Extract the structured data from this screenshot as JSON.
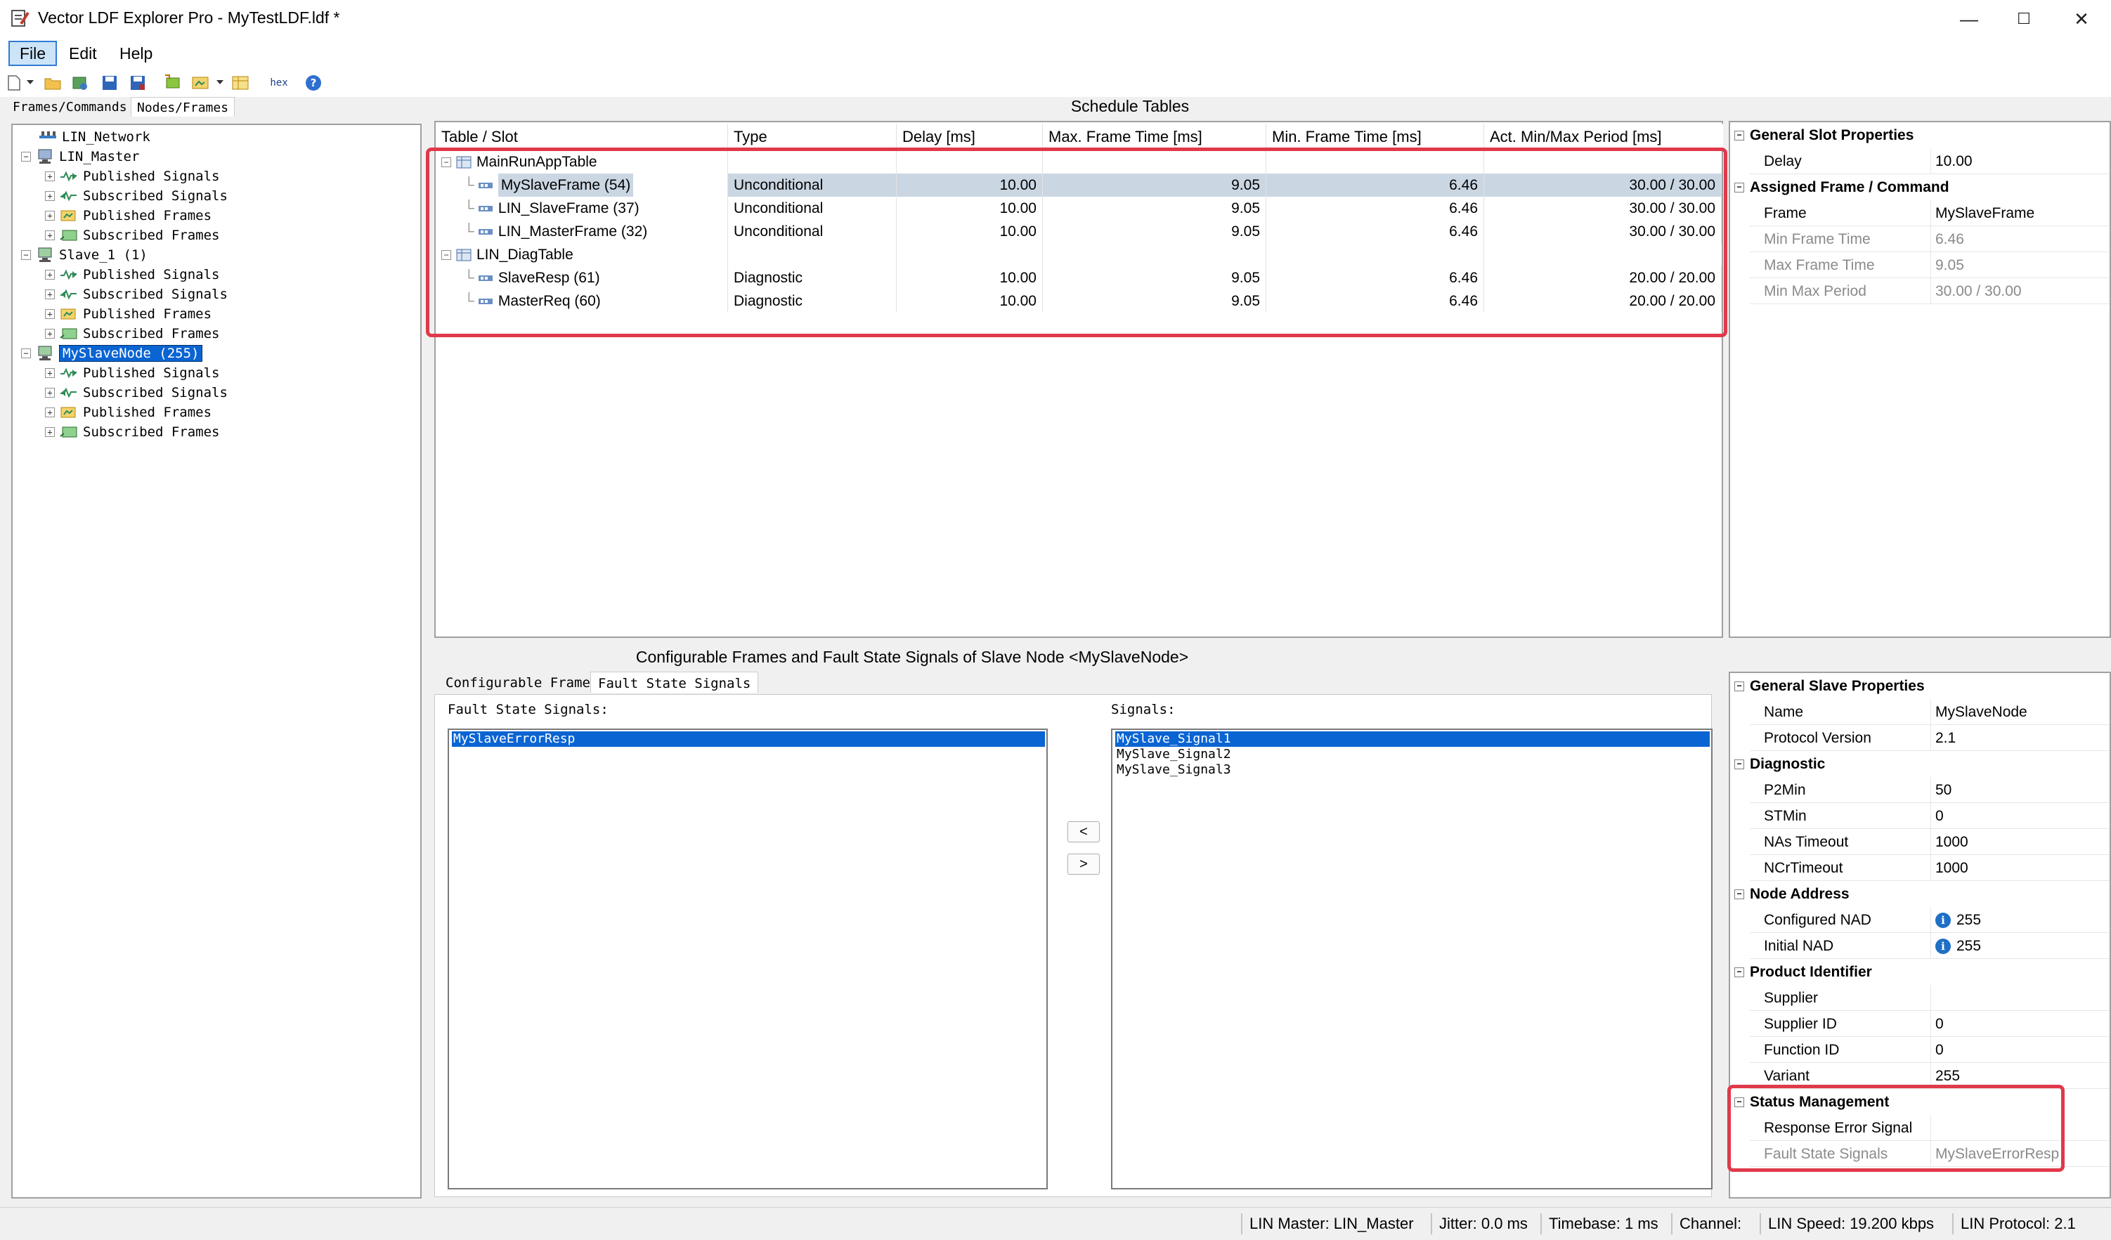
{
  "window": {
    "title": "Vector LDF Explorer Pro - MyTestLDF.ldf *",
    "minimize": "—",
    "maximize": "☐",
    "close": "✕"
  },
  "menu": {
    "file": "File",
    "edit": "Edit",
    "help": "Help"
  },
  "toolbar": {
    "hex_label": "hex"
  },
  "left_tabs": {
    "frames_commands": "Frames/Commands",
    "nodes_frames": "Nodes/Frames"
  },
  "tree": {
    "network": "LIN_Network",
    "master": "LIN_Master",
    "master_children": [
      "Published Signals",
      "Subscribed Signals",
      "Published Frames",
      "Subscribed Frames"
    ],
    "slave1": "Slave_1 (1)",
    "slave1_children": [
      "Published Signals",
      "Subscribed Signals",
      "Published Frames",
      "Subscribed Frames"
    ],
    "myslave": "MySlaveNode (255)",
    "myslave_children": [
      "Published Signals",
      "Subscribed Signals",
      "Published Frames",
      "Subscribed Frames"
    ]
  },
  "schedule": {
    "title": "Schedule Tables",
    "columns": [
      "Table / Slot",
      "Type",
      "Delay [ms]",
      "Max. Frame Time [ms]",
      "Min. Frame Time [ms]",
      "Act. Min/Max Period [ms]"
    ],
    "tables": [
      {
        "name": "MainRunAppTable",
        "slots": [
          {
            "name": "MySlaveFrame (54)",
            "type": "Unconditional",
            "delay": "10.00",
            "max": "9.05",
            "min": "6.46",
            "period": "30.00 / 30.00",
            "selected": true
          },
          {
            "name": "LIN_SlaveFrame (37)",
            "type": "Unconditional",
            "delay": "10.00",
            "max": "9.05",
            "min": "6.46",
            "period": "30.00 / 30.00"
          },
          {
            "name": "LIN_MasterFrame (32)",
            "type": "Unconditional",
            "delay": "10.00",
            "max": "9.05",
            "min": "6.46",
            "period": "30.00 / 30.00"
          }
        ]
      },
      {
        "name": "LIN_DiagTable",
        "slots": [
          {
            "name": "SlaveResp (61)",
            "type": "Diagnostic",
            "delay": "10.00",
            "max": "9.05",
            "min": "6.46",
            "period": "20.00 / 20.00"
          },
          {
            "name": "MasterReq (60)",
            "type": "Diagnostic",
            "delay": "10.00",
            "max": "9.05",
            "min": "6.46",
            "period": "20.00 / 20.00"
          }
        ]
      }
    ]
  },
  "slot_props": {
    "general_title": "General Slot Properties",
    "delay_label": "Delay",
    "delay_value": "10.00",
    "assigned_title": "Assigned Frame / Command",
    "frame_label": "Frame",
    "frame_value": "MySlaveFrame",
    "min_frame_label": "Min Frame Time",
    "min_frame_value": "6.46",
    "max_frame_label": "Max Frame Time",
    "max_frame_value": "9.05",
    "minmax_label": "Min Max Period",
    "minmax_value": "30.00 / 30.00"
  },
  "config": {
    "title": "Configurable Frames and Fault State Signals of Slave Node <MySlaveNode>",
    "tab_configurable": "Configurable Frames",
    "tab_fault": "Fault State Signals",
    "fault_label": "Fault State Signals:",
    "fault_items": [
      "MySlaveErrorResp"
    ],
    "signals_label": "Signals:",
    "signal_items": [
      "MySlave_Signal1",
      "MySlave_Signal2",
      "MySlave_Signal3"
    ],
    "btn_left": "<",
    "btn_right": ">"
  },
  "slave_props": {
    "general_title": "General Slave Properties",
    "name_label": "Name",
    "name_value": "MySlaveNode",
    "protocol_label": "Protocol Version",
    "protocol_value": "2.1",
    "diag_title": "Diagnostic",
    "p2min_label": "P2Min",
    "p2min_value": "50",
    "stmin_label": "STMin",
    "stmin_value": "0",
    "nas_label": "NAs Timeout",
    "nas_value": "1000",
    "ncr_label": "NCrTimeout",
    "ncr_value": "1000",
    "nad_title": "Node Address",
    "conf_nad_label": "Configured NAD",
    "conf_nad_value": "255",
    "init_nad_label": "Initial NAD",
    "init_nad_value": "255",
    "info_glyph": "i",
    "prod_title": "Product Identifier",
    "supplier_label": "Supplier",
    "supplier_value": "",
    "supplier_id_label": "Supplier ID",
    "supplier_id_value": "0",
    "function_id_label": "Function ID",
    "function_id_value": "0",
    "variant_label": "Variant",
    "variant_value": "255",
    "status_title": "Status Management",
    "resp_err_label": "Response Error Signal",
    "resp_err_value": "",
    "fault_state_label": "Fault State Signals",
    "fault_state_value": "MySlaveErrorResp"
  },
  "status": {
    "master": "LIN Master: LIN_Master",
    "jitter": "Jitter: 0.0 ms",
    "timebase": "Timebase: 1 ms",
    "channel": "Channel:",
    "speed": "LIN Speed: 19.200 kbps",
    "protocol": "LIN Protocol: 2.1"
  },
  "colors": {
    "selection": "#0a64d2",
    "row_selected": "#cbd6e3",
    "highlight_box": "#e0394a"
  }
}
